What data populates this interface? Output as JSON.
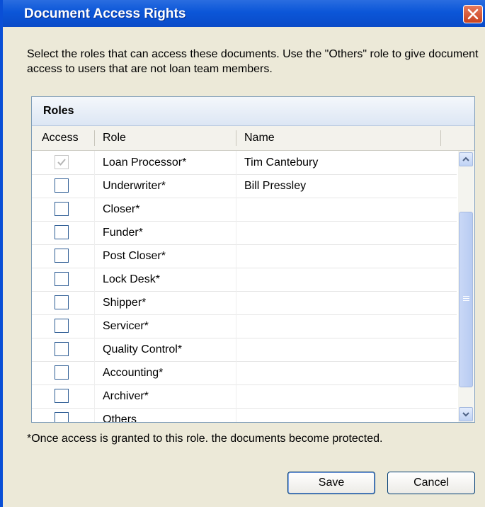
{
  "window": {
    "title": "Document Access Rights"
  },
  "instructions": "Select the roles that can access these documents. Use the \"Others\" role to give document access to users that are not loan team members.",
  "panel": {
    "title": "Roles",
    "columns": {
      "access": "Access",
      "role": "Role",
      "name": "Name"
    },
    "rows": [
      {
        "role": "Loan Processor*",
        "name": "Tim Cantebury",
        "checked": true,
        "disabled": true
      },
      {
        "role": "Underwriter*",
        "name": "Bill Pressley",
        "checked": false,
        "disabled": false
      },
      {
        "role": "Closer*",
        "name": "",
        "checked": false,
        "disabled": false
      },
      {
        "role": "Funder*",
        "name": "",
        "checked": false,
        "disabled": false
      },
      {
        "role": "Post Closer*",
        "name": "",
        "checked": false,
        "disabled": false
      },
      {
        "role": "Lock Desk*",
        "name": "",
        "checked": false,
        "disabled": false
      },
      {
        "role": "Shipper*",
        "name": "",
        "checked": false,
        "disabled": false
      },
      {
        "role": "Servicer*",
        "name": "",
        "checked": false,
        "disabled": false
      },
      {
        "role": "Quality Control*",
        "name": "",
        "checked": false,
        "disabled": false
      },
      {
        "role": "Accounting*",
        "name": "",
        "checked": false,
        "disabled": false
      },
      {
        "role": "Archiver*",
        "name": "",
        "checked": false,
        "disabled": false
      },
      {
        "role": "Others",
        "name": "",
        "checked": false,
        "disabled": false
      }
    ]
  },
  "footnote": "*Once access is granted to this role. the documents become protected.",
  "buttons": {
    "save": "Save",
    "cancel": "Cancel"
  },
  "colors": {
    "title_bar": "#0b56d8",
    "dialog_bg": "#ece9d8",
    "close_button": "#c8421f",
    "panel_header": "#dce6f4"
  },
  "icons": {
    "close": "close-icon",
    "scroll_up": "chevron-up-icon",
    "scroll_down": "chevron-down-icon",
    "check": "check-icon"
  }
}
